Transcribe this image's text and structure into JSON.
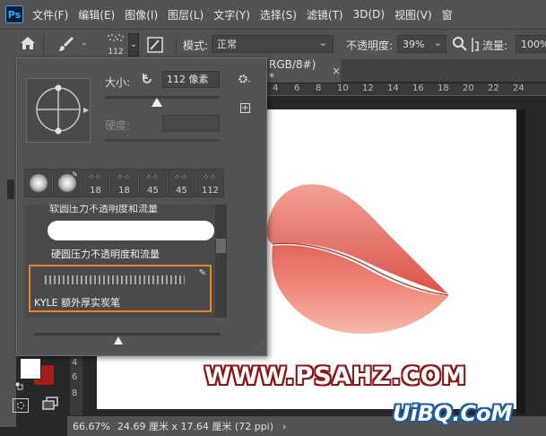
{
  "app": {
    "logo": "Ps"
  },
  "menu": [
    "文件(F)",
    "编辑(E)",
    "图像(I)",
    "图层(L)",
    "文字(Y)",
    "选择(S)",
    "滤镜(T)",
    "3D(D)",
    "视图(V)",
    "窗"
  ],
  "options": {
    "brush_size_small": "112",
    "mode_label": "模式:",
    "mode_value": "正常",
    "opacity_label": "不透明度:",
    "opacity_value": "39%",
    "flow_label": "流量:",
    "flow_value": "100%"
  },
  "tab": {
    "title": "RGB/8#) *",
    "close": "×"
  },
  "ruler": {
    "h_ticks": [
      "4",
      "6",
      "8",
      "10",
      "12",
      "14",
      "16",
      "18",
      "20",
      "22",
      "24"
    ],
    "v_ticks": [
      "2",
      "4",
      "6",
      "8"
    ]
  },
  "panel": {
    "size_label": "大小:",
    "size_value": "112 像素",
    "hardness_label": "硬度:",
    "size_slider_fraction": 0.45,
    "thumbs": [
      {
        "num": ""
      },
      {
        "num": ""
      },
      {
        "num": "18"
      },
      {
        "num": "18"
      },
      {
        "num": "45"
      },
      {
        "num": "45"
      },
      {
        "num": "112"
      }
    ],
    "list_items": [
      "软圆压力不透明度和流量",
      "硬圆压力不透明度和流量",
      "KYLE 额外厚实炭笔"
    ],
    "bottom_slider_fraction": 0.45
  },
  "status": {
    "zoom": "66.67%",
    "doc_size": "24.69 厘米 x 17.64 厘米 (72 ppi)",
    "arrow": "›"
  },
  "watermark": "WWW.PSAHZ.COM",
  "site_mark": "UiBQ.CoM",
  "colors": {
    "accent": "#e8832a",
    "foreground": "#ffffff",
    "background": "#a31d1a"
  }
}
